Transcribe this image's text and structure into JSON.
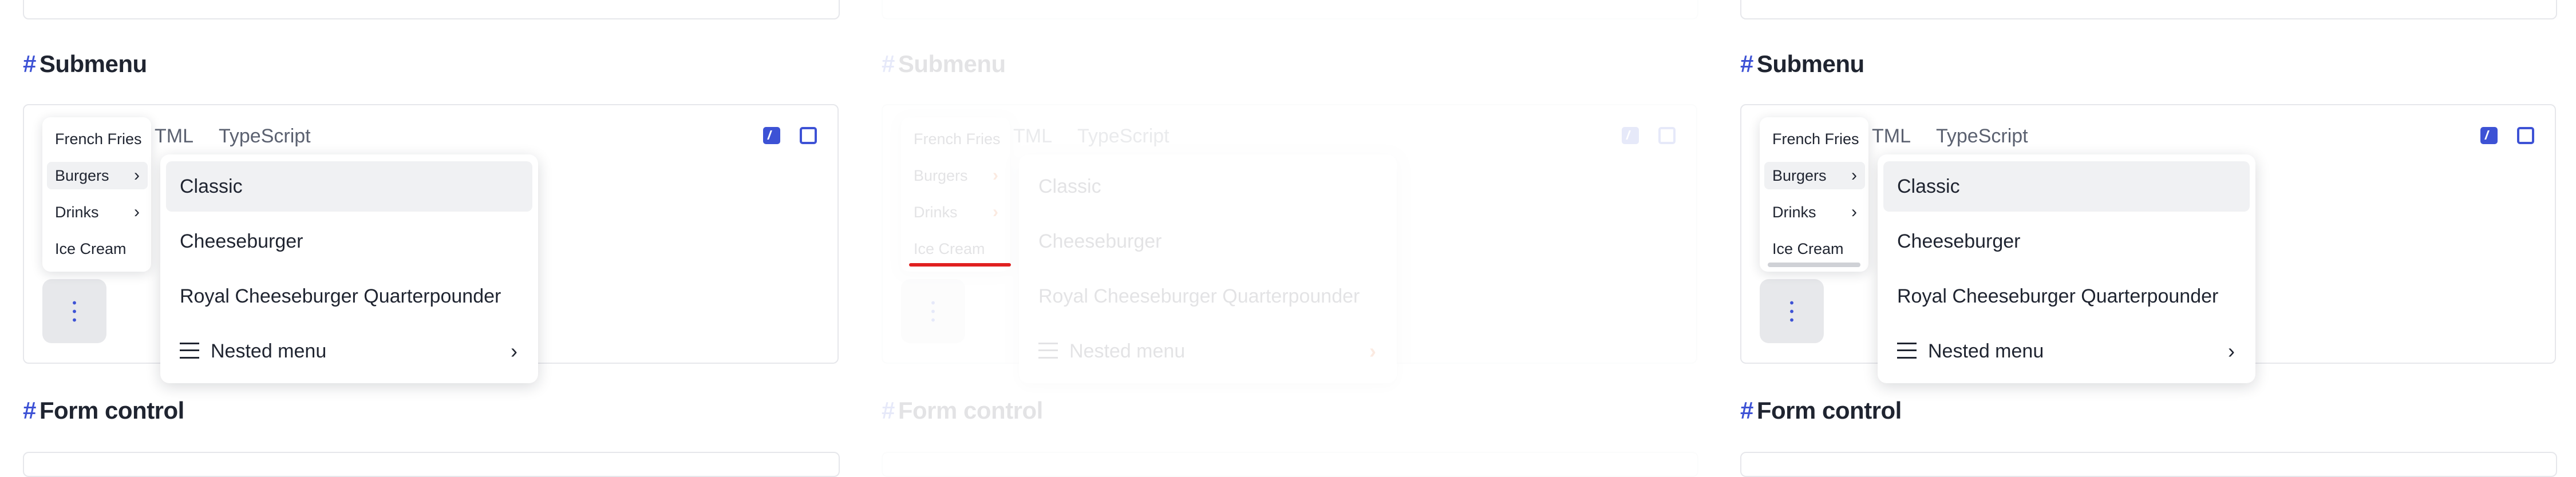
{
  "section": {
    "hash": "#",
    "title": "Submenu",
    "next_title": "Form control"
  },
  "tabs": [
    "HTML",
    "TypeScript"
  ],
  "submenu": {
    "items": [
      {
        "label": "French Fries",
        "has_children": false
      },
      {
        "label": "Burgers",
        "has_children": true
      },
      {
        "label": "Drinks",
        "has_children": true
      },
      {
        "label": "Ice Cream",
        "has_children": false
      }
    ]
  },
  "nested_menu": {
    "items": [
      {
        "label": "Classic"
      },
      {
        "label": "Cheeseburger"
      },
      {
        "label": "Royal Cheeseburger Quarterpounder"
      },
      {
        "label": "Nested menu",
        "has_children": true
      }
    ]
  },
  "icons": {
    "chevron": "chevron-right-icon",
    "menu": "menu-lines-icon",
    "kebab": "more-vertical-icon",
    "bolt": "bolt-icon",
    "expand": "expand-icon"
  },
  "colors": {
    "accent": "#3d52d5",
    "highlight": "#e35a0f",
    "underline": "#e02020"
  }
}
